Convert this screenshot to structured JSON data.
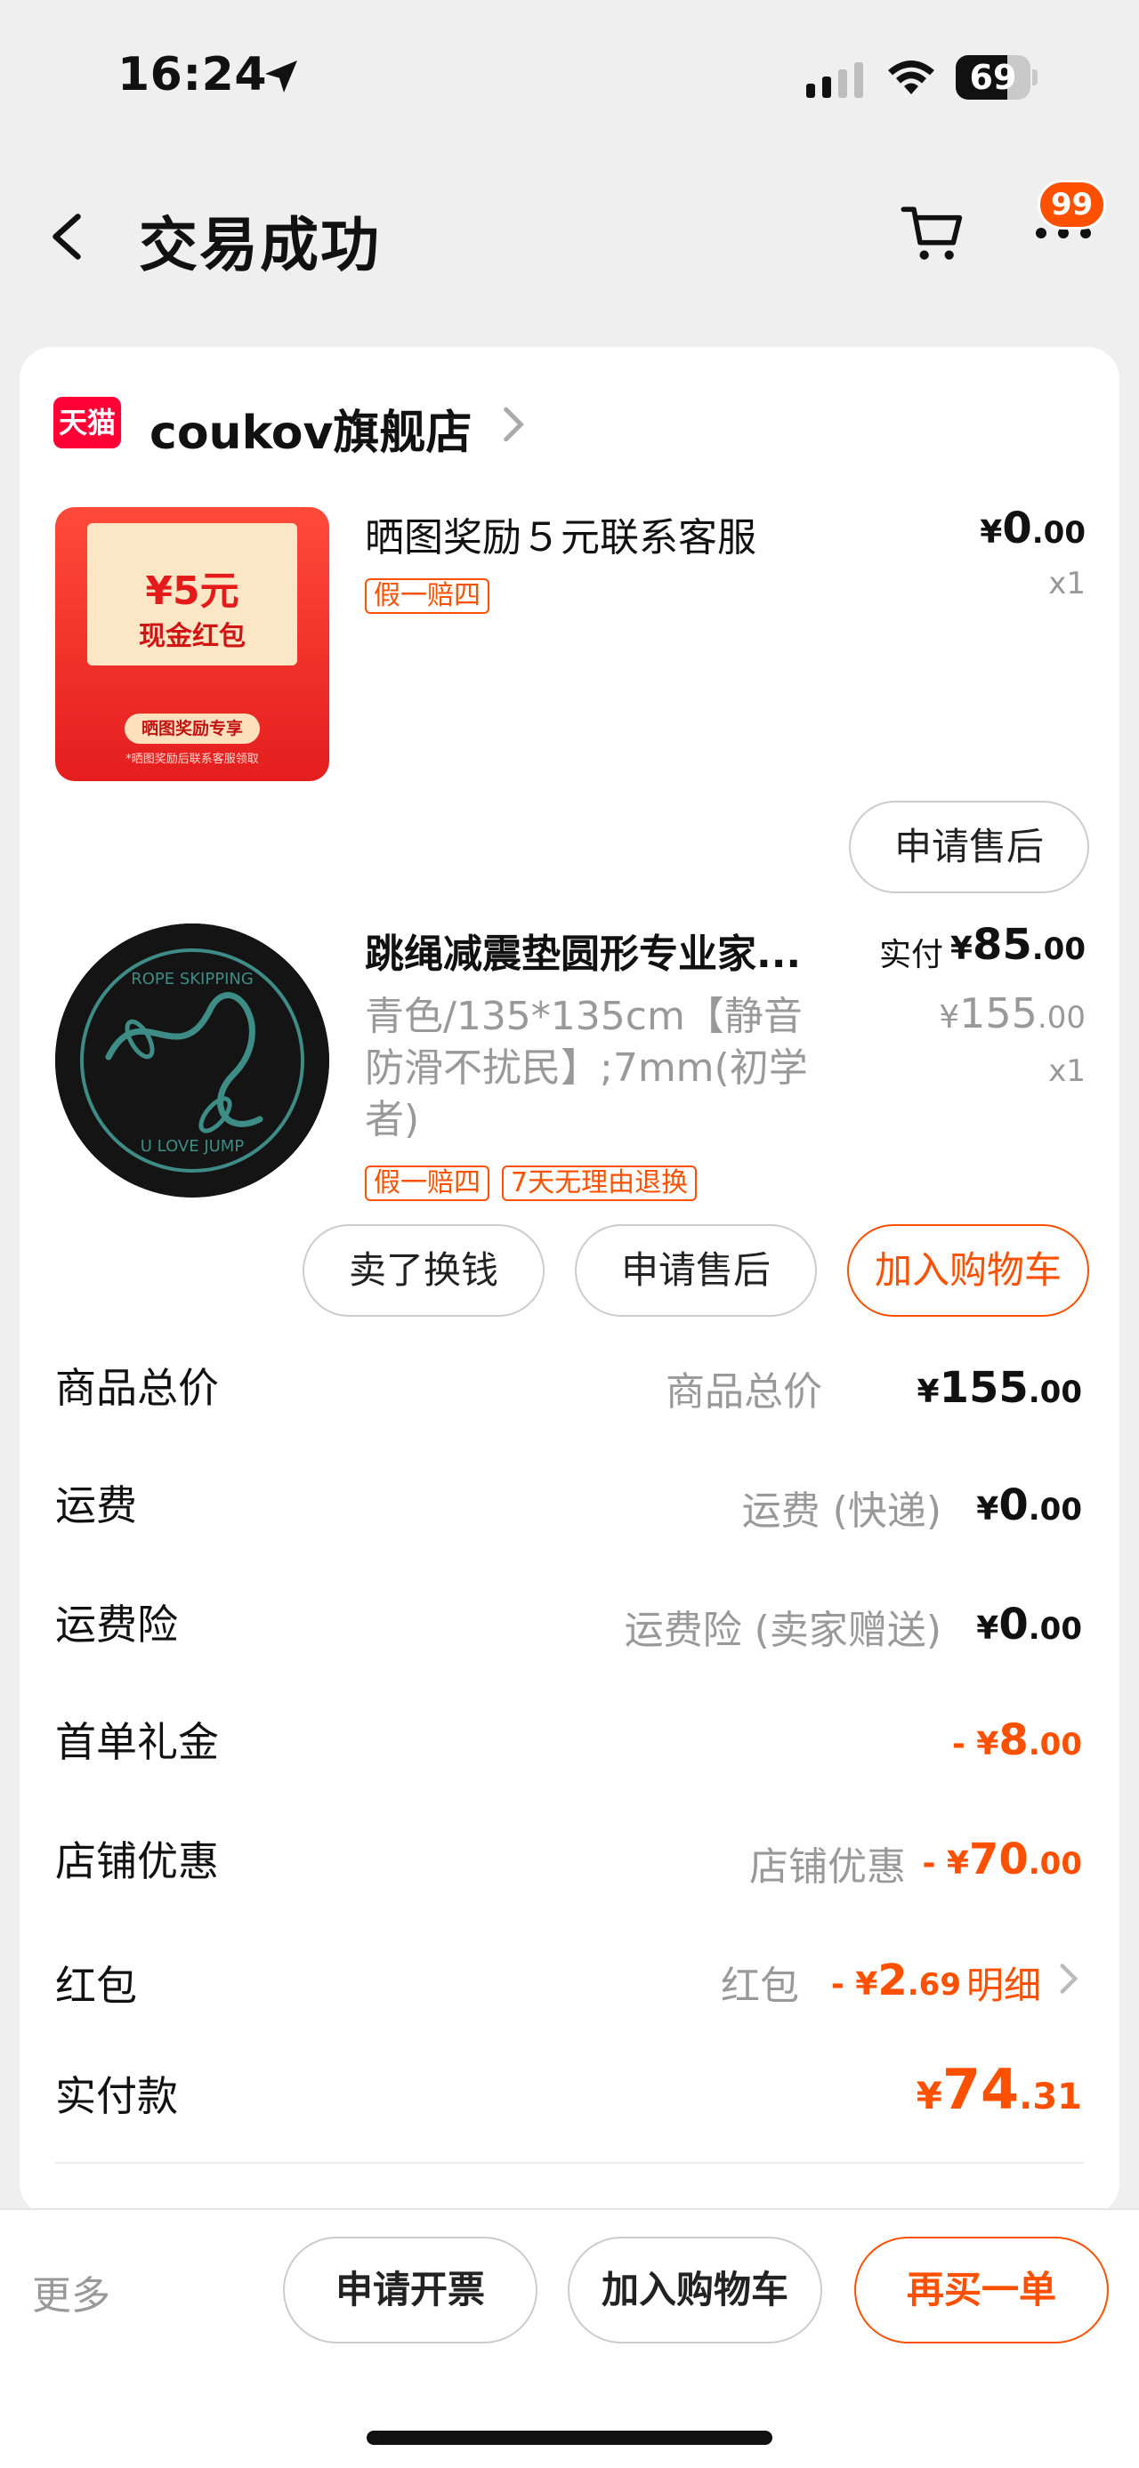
{
  "status_bar": {
    "time": "16:24",
    "battery": "69",
    "battery_level": 0.69
  },
  "header": {
    "title": "交易成功",
    "badge": "99"
  },
  "shop": {
    "logo_text": "天猫",
    "name": "coukov旗舰店"
  },
  "product1": {
    "title": "晒图奖励５元联系客服",
    "tag": "假一赔四",
    "price": {
      "yen": "¥",
      "int": "0",
      "dec": ".00"
    },
    "qty": "x1",
    "image_text": {
      "amount": "¥5元",
      "label": "现金红包",
      "pill": "晒图奖励专享",
      "note": "*晒图奖励后联系客服领取"
    },
    "after_sale_label": "申请售后"
  },
  "product2": {
    "title": "跳绳减震垫圆形专业家...",
    "spec": "青色/135*135cm【静音防滑不扰民】;7mm(初学者)",
    "tags": [
      "假一赔四",
      "7天无理由退换"
    ],
    "paid_label": "实付",
    "paid": {
      "yen": "¥",
      "int": "85",
      "dec": ".00"
    },
    "orig": {
      "yen": "¥",
      "int": "155",
      "dec": ".00"
    },
    "qty": "x1",
    "image_text": {
      "top": "ROPE SKIPPING",
      "bottom": "U LOVE JUMP"
    },
    "buttons": {
      "sell": "卖了换钱",
      "after_sale": "申请售后",
      "add_cart": "加入购物车"
    }
  },
  "summary": {
    "total": {
      "label": "商品总价",
      "sub": "商品总价",
      "yen": "¥",
      "int": "155",
      "dec": ".00"
    },
    "shipping": {
      "label": "运费",
      "sub": "运费 (快递)",
      "yen": "¥",
      "int": "0",
      "dec": ".00"
    },
    "ship_ins": {
      "label": "运费险",
      "sub": "运费险 (卖家赠送)",
      "yen": "¥",
      "int": "0",
      "dec": ".00"
    },
    "first_gift": {
      "label": "首单礼金",
      "yen": "- ¥",
      "int": "8",
      "dec": ".00"
    },
    "shop_discount": {
      "label": "店铺优惠",
      "sub": "店铺优惠",
      "yen": "- ¥",
      "int": "70",
      "dec": ".00"
    },
    "red_packet": {
      "label": "红包",
      "sub": "红包",
      "yen": "- ¥",
      "int": "2",
      "dec": ".69",
      "detail": "明细"
    },
    "paid": {
      "label": "实付款",
      "yen": "¥",
      "int": "74",
      "dec": ".31"
    }
  },
  "bottom_bar": {
    "more": "更多",
    "invoice": "申请开票",
    "add_cart": "加入购物车",
    "rebuy": "再买一单"
  },
  "colors": {
    "accent": "#ff5000",
    "tmall": "#ff0036",
    "background": "#efefef"
  }
}
